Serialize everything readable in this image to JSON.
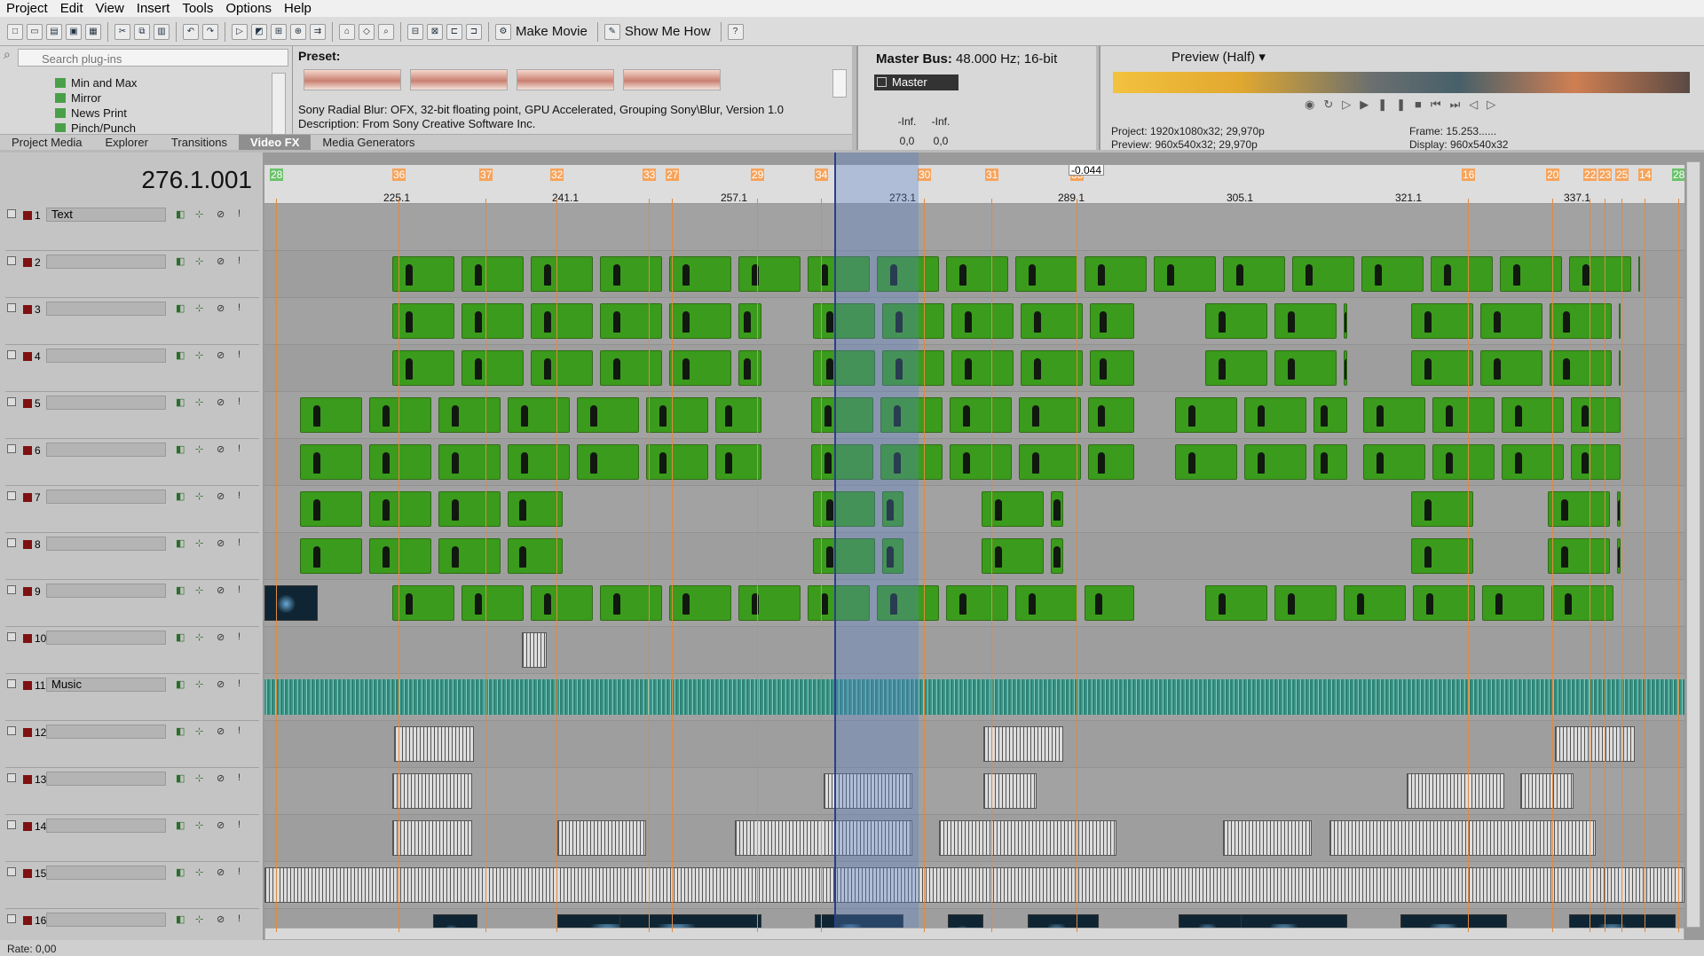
{
  "menu": [
    "Project",
    "Edit",
    "View",
    "Insert",
    "Tools",
    "Options",
    "Help"
  ],
  "toolbar": {
    "make_movie": "Make Movie",
    "show_me_how": "Show Me How"
  },
  "plugins": {
    "search_placeholder": "Search plug-ins",
    "items": [
      "Min and Max",
      "Mirror",
      "News Print",
      "Pinch/Punch"
    ]
  },
  "preset": {
    "label": "Preset:",
    "info_line1": "Sony Radial Blur: OFX, 32-bit floating point, GPU Accelerated, Grouping Sony\\Blur, Version 1.0",
    "info_line2": "Description: From Sony Creative Software Inc."
  },
  "dock_tabs": [
    "Project Media",
    "Explorer",
    "Transitions",
    "Video FX",
    "Media Generators"
  ],
  "master": {
    "title": "Master Bus:",
    "spec": "48.000 Hz; 16-bit",
    "strip": "Master",
    "inf_l": "-Inf.",
    "inf_r": "-Inf.",
    "val_l": "0,0",
    "val_r": "0,0"
  },
  "preview": {
    "mode": "Preview (Half)",
    "project_label": "Project:",
    "project_val": "1920x1080x32; 29,970p",
    "preview_label": "Preview:",
    "preview_val": "960x540x32; 29,970p",
    "frame_label": "Frame:",
    "frame_val": "15.253......",
    "display_label": "Display:",
    "display_val": "960x540x32"
  },
  "timeline": {
    "timecode": "276.1.001",
    "ruler_ticks": [
      "225.1",
      "241.1",
      "257.1",
      "273.1",
      "289.1",
      "305.1",
      "321.1",
      "337.1"
    ],
    "markers": [
      "28",
      "36",
      "37",
      "32",
      "33",
      "27",
      "29",
      "34",
      "30",
      "31",
      "35",
      "16",
      "20",
      "22",
      "23",
      "25",
      "14",
      "28"
    ],
    "region_label": "-0.044"
  },
  "tracks": [
    {
      "num": "1",
      "name": "Text"
    },
    {
      "num": "2",
      "name": ""
    },
    {
      "num": "3",
      "name": ""
    },
    {
      "num": "4",
      "name": ""
    },
    {
      "num": "5",
      "name": ""
    },
    {
      "num": "6",
      "name": ""
    },
    {
      "num": "7",
      "name": ""
    },
    {
      "num": "8",
      "name": ""
    },
    {
      "num": "9",
      "name": ""
    },
    {
      "num": "10",
      "name": ""
    },
    {
      "num": "11",
      "name": "Music"
    },
    {
      "num": "12",
      "name": ""
    },
    {
      "num": "13",
      "name": ""
    },
    {
      "num": "14",
      "name": ""
    },
    {
      "num": "15",
      "name": ""
    },
    {
      "num": "16",
      "name": ""
    }
  ],
  "status": {
    "rate": "Rate: 0,00"
  }
}
